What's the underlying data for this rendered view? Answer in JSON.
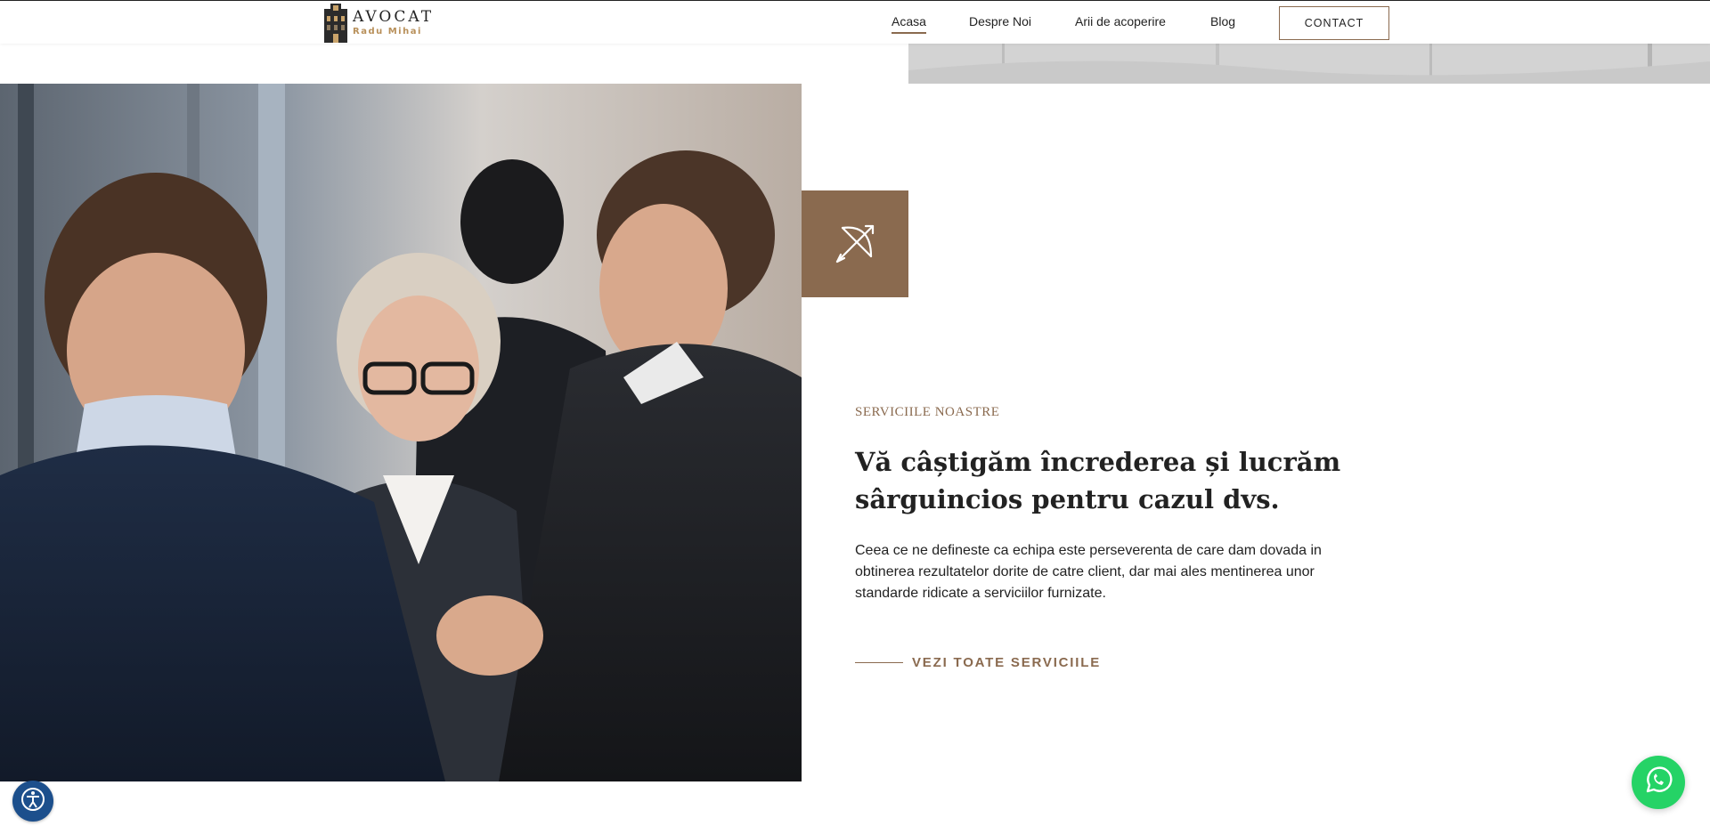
{
  "header": {
    "logo": {
      "title": "AVOCAT",
      "subtitle": "Radu Mihai"
    },
    "nav": [
      {
        "label": "Acasa",
        "active": true
      },
      {
        "label": "Despre Noi",
        "active": false
      },
      {
        "label": "Arii de acoperire",
        "active": false
      },
      {
        "label": "Blog",
        "active": false
      }
    ],
    "contact_label": "CONTACT"
  },
  "services": {
    "icon": "bow-arrow-icon",
    "eyebrow": "SERVICIILE NOASTRE",
    "headline": "Vă câștigăm încrederea și lucrăm sârguincios pentru cazul dvs.",
    "paragraph": "Ceea ce ne defineste ca echipa este perseverenta de care dam dovada in obtinerea rezultatelor dorite de catre client, dar mai ales mentinerea unor standarde ridicate a serviciilor furnizate.",
    "cta_label": "VEZI TOATE SERVICIILE"
  },
  "widgets": {
    "accessibility_icon": "accessibility-icon",
    "whatsapp_icon": "whatsapp-icon"
  },
  "colors": {
    "accent": "#8a6a4f",
    "whatsapp": "#25d366",
    "accessibility": "#1c4f8c"
  }
}
